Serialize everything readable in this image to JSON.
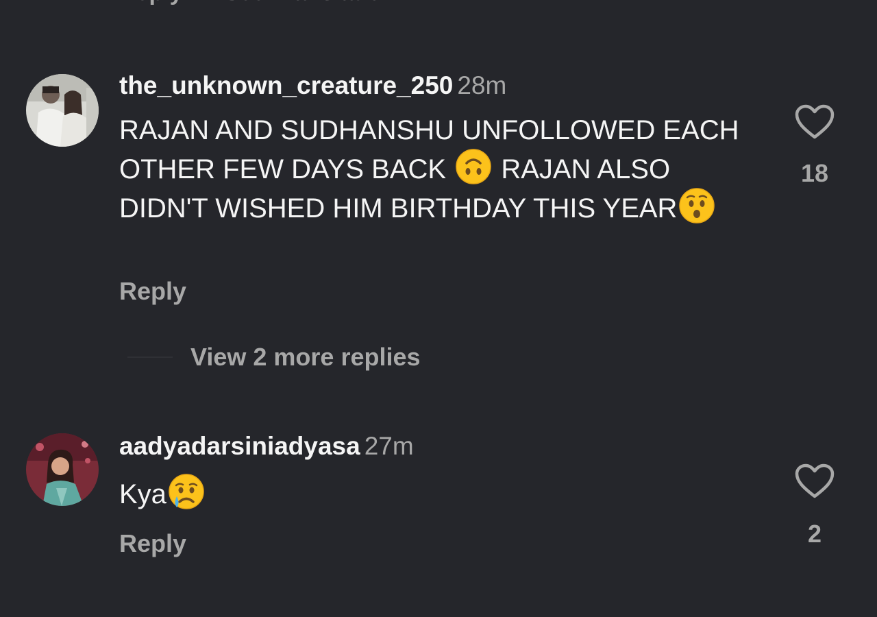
{
  "top_cut": {
    "reply_label": "Reply",
    "see_translation_label": "See Translation"
  },
  "comments": [
    {
      "username": "the_unknown_creature_250",
      "time": "28m",
      "text_parts": [
        "RAJAN AND SUDHANSHU UNFOLLOWED EACH OTHER FEW DAYS BACK ",
        " RAJAN ALSO DIDN'T WISHED HIM BIRTHDAY THIS YEAR"
      ],
      "emojis": [
        "upside-down-face-emoji",
        "hushed-face-emoji"
      ],
      "reply_label": "Reply",
      "like_count": "18"
    },
    {
      "username": "aadyadarsiniadyasa",
      "time": "27m",
      "text_parts": [
        "Kya"
      ],
      "emojis": [
        "crying-face-emoji"
      ],
      "reply_label": "Reply",
      "like_count": "2"
    }
  ],
  "view_replies": {
    "label": "View 2 more replies"
  },
  "colors": {
    "background": "#25262b",
    "primary_text": "#f5f5f5",
    "secondary_text": "#a8a8a8",
    "emoji_yellow": "#fcc21b"
  }
}
